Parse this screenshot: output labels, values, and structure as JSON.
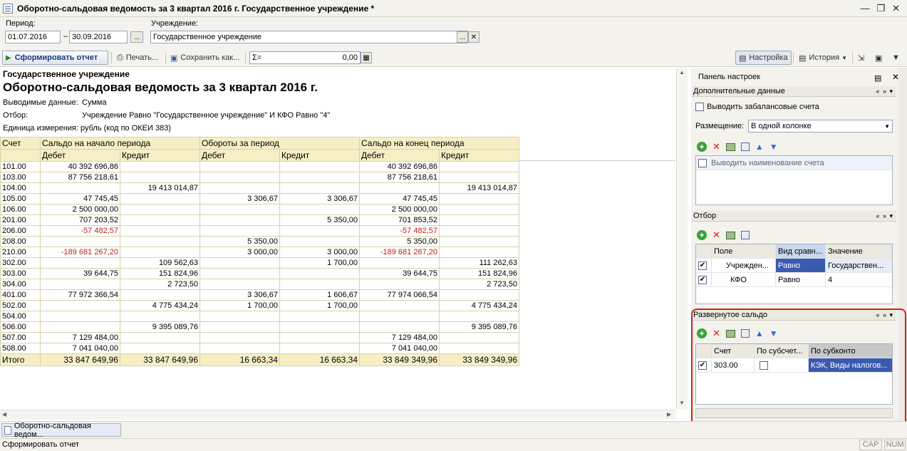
{
  "window": {
    "title": "Оборотно-сальдовая ведомость за 3 квартал 2016 г. Государственное учреждение *"
  },
  "params": {
    "period_label": "Период:",
    "date_from": "01.07.2016",
    "dash": "–",
    "date_to": "30.09.2016",
    "ellipsis": "...",
    "inst_label": "Учреждение:",
    "inst_value": "Государственное учреждение"
  },
  "toolbar": {
    "generate": "Сформировать отчет",
    "print": "Печать...",
    "save": "Сохранить как...",
    "sum_value": "0,00",
    "settings": "Настройка",
    "history": "История"
  },
  "report": {
    "org": "Государственное учреждение",
    "title": "Оборотно-сальдовая ведомость за 3 квартал 2016 г.",
    "output_label": "Выводимые данные:",
    "output_value": "Сумма",
    "filter_label": "Отбор:",
    "filter_value": "Учреждение Равно \"Государственное учреждение\" И КФО Равно \"4\"",
    "unit": "Единица измерения: рубль (код по ОКЕИ 383)"
  },
  "table": {
    "h_account": "Счет",
    "h_open": "Сальдо на начало периода",
    "h_turn": "Обороты за период",
    "h_close": "Сальдо на конец периода",
    "h_debit": "Дебет",
    "h_credit": "Кредит",
    "rows": [
      [
        "101.00",
        "40 392 696,86",
        "",
        "",
        "",
        "40 392 696,86",
        ""
      ],
      [
        "103.00",
        "87 756 218,61",
        "",
        "",
        "",
        "87 756 218,61",
        ""
      ],
      [
        "104.00",
        "",
        "19 413 014,87",
        "",
        "",
        "",
        "19 413 014,87"
      ],
      [
        "105.00",
        "47 745,45",
        "",
        "3 306,67",
        "3 306,67",
        "47 745,45",
        ""
      ],
      [
        "106.00",
        "2 500 000,00",
        "",
        "",
        "",
        "2 500 000,00",
        ""
      ],
      [
        "201.00",
        "707 203,52",
        "",
        "",
        "5 350,00",
        "701 853,52",
        ""
      ],
      [
        "206.00",
        "-57 482,57",
        "",
        "",
        "",
        "-57 482,57",
        ""
      ],
      [
        "208.00",
        "",
        "",
        "5 350,00",
        "",
        "5 350,00",
        ""
      ],
      [
        "210.00",
        "-189 681 267,20",
        "",
        "3 000,00",
        "3 000,00",
        "-189 681 267,20",
        ""
      ],
      [
        "302.00",
        "",
        "109 562,63",
        "",
        "1 700,00",
        "",
        "111 262,63"
      ],
      [
        "303.00",
        "39 644,75",
        "151 824,96",
        "",
        "",
        "39 644,75",
        "151 824,96"
      ],
      [
        "304.00",
        "",
        "2 723,50",
        "",
        "",
        "",
        "2 723,50"
      ],
      [
        "401.00",
        "77 972 366,54",
        "",
        "3 306,67",
        "1 606,67",
        "77 974 066,54",
        ""
      ],
      [
        "502.00",
        "",
        "4 775 434,24",
        "1 700,00",
        "1 700,00",
        "",
        "4 775 434,24"
      ],
      [
        "504.00",
        "",
        "",
        "",
        "",
        "",
        ""
      ],
      [
        "506.00",
        "",
        "9 395 089,76",
        "",
        "",
        "",
        "9 395 089,76"
      ],
      [
        "507.00",
        "7 129 484,00",
        "",
        "",
        "",
        "7 129 484,00",
        ""
      ],
      [
        "508.00",
        "7 041 040,00",
        "",
        "",
        "",
        "7 041 040,00",
        ""
      ]
    ],
    "total": [
      "Итого",
      "33 847 649,96",
      "33 847 649,96",
      "16 663,34",
      "16 663,34",
      "33 849 349,96",
      "33 849 349,96"
    ]
  },
  "panel": {
    "title": "Панель настроек",
    "extra": {
      "header": "Дополнительные данные",
      "offbalance": "Выводить забалансовые счета",
      "placement_label": "Размещение:",
      "placement_value": "В одной колонке",
      "show_name": "Выводить наименование счета"
    },
    "filter": {
      "header": "Отбор",
      "col_field": "Поле",
      "col_cmp": "Вид сравн...",
      "col_value": "Значение",
      "rows": [
        [
          "Учрежден...",
          "Равно",
          "Государствен..."
        ],
        [
          "КФО",
          "Равно",
          "4"
        ]
      ]
    },
    "saldo": {
      "header": "Развернутое сальдо",
      "col_acc": "Счет",
      "col_sub": "По субсчет...",
      "col_subk": "По субконто",
      "row": [
        "303.00",
        "КЭК, Виды налогов..."
      ]
    }
  },
  "taskbar": {
    "item": "Оборотно-сальдовая ведом..."
  },
  "status": {
    "text": "Сформировать отчет",
    "cap": "CAP",
    "num": "NUM"
  },
  "colors": {
    "header_bg": "#f6efc6",
    "grid_border": "#d8d2a8",
    "negative": "#c02020",
    "selection": "#3a5ab0",
    "highlight_box": "#d02020"
  }
}
